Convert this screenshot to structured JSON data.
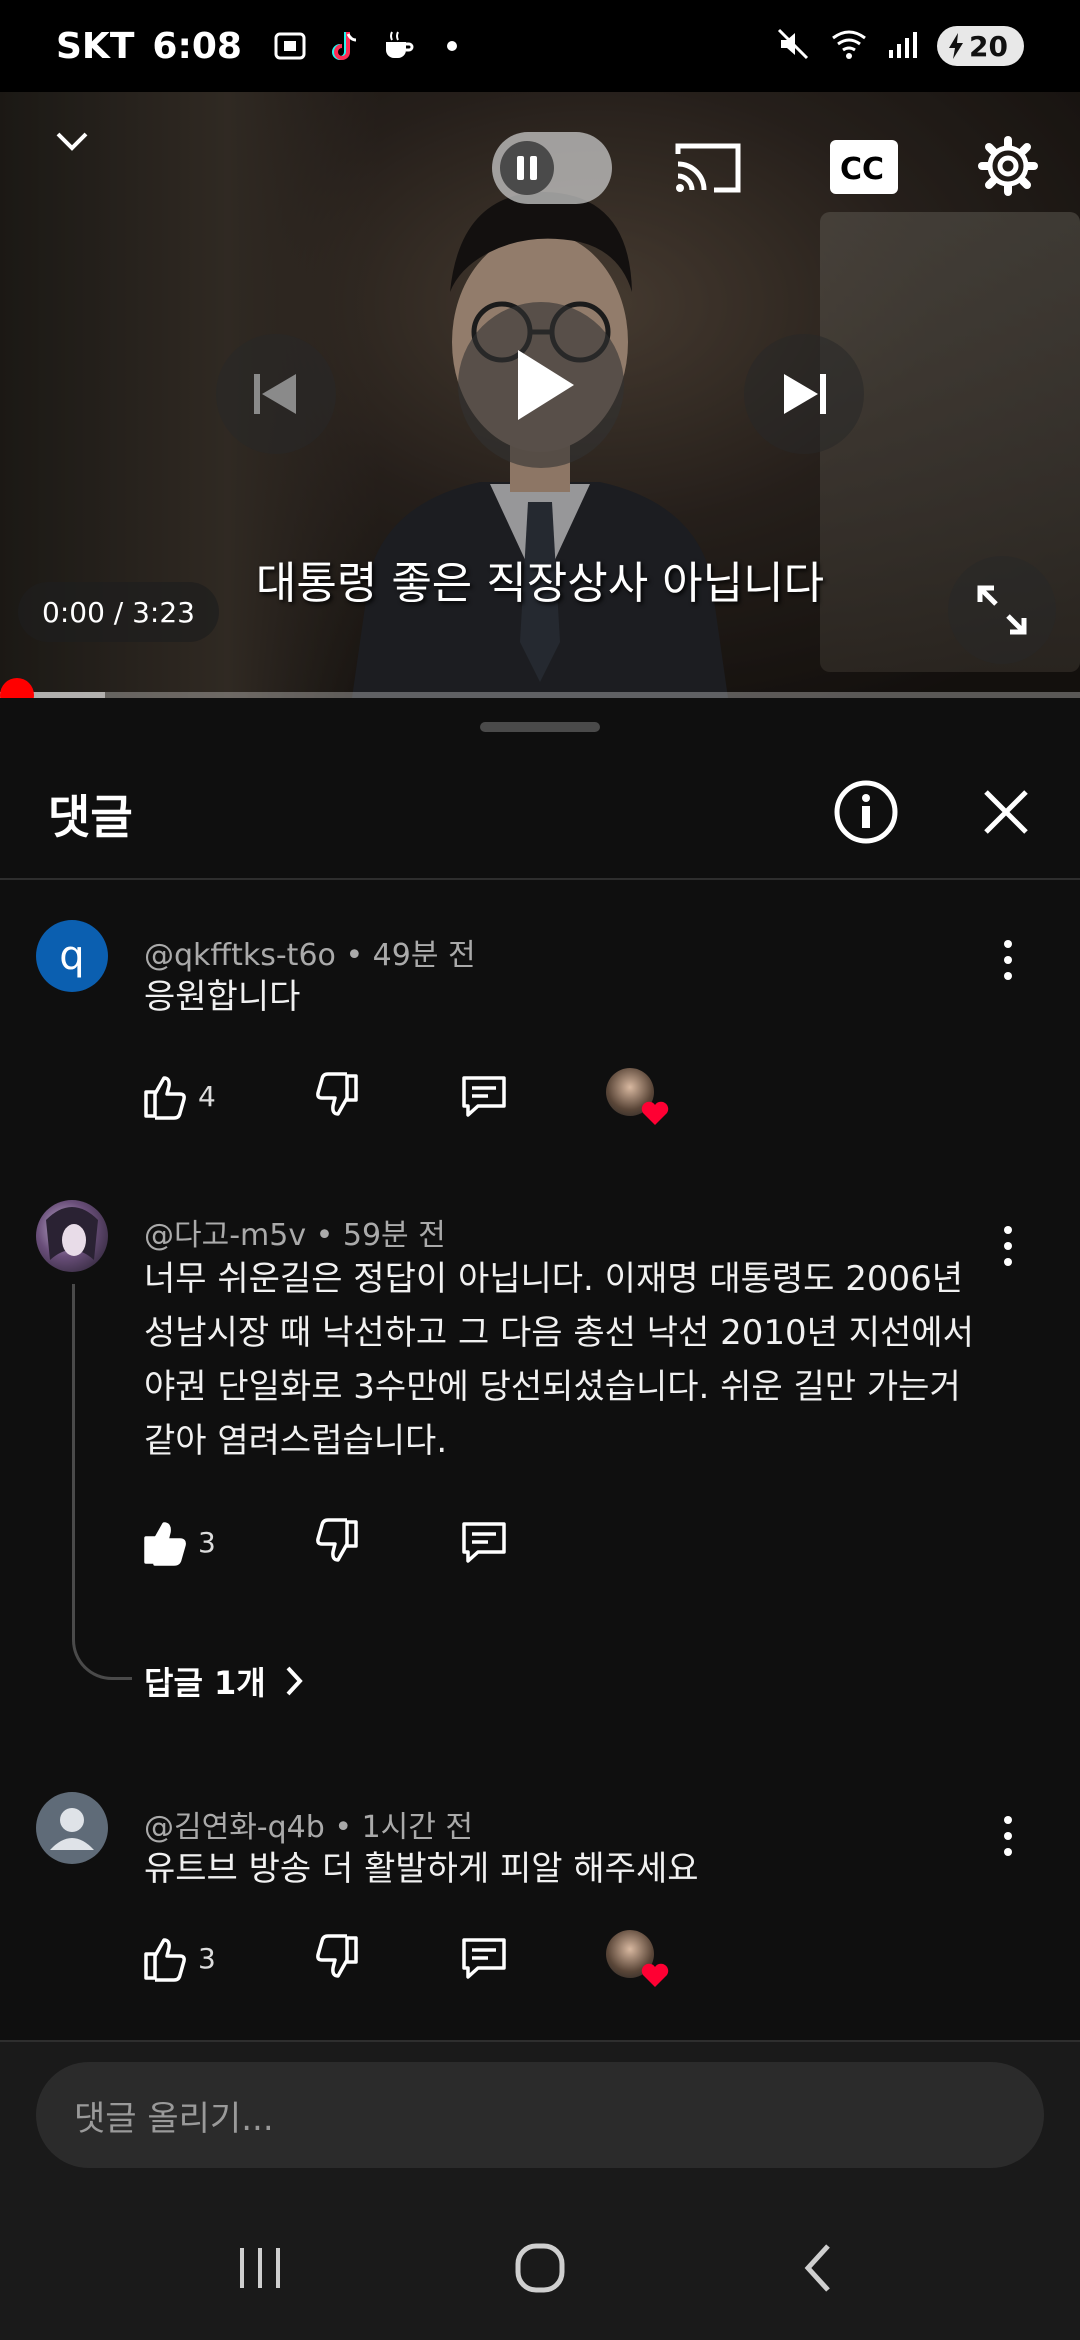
{
  "status_bar": {
    "carrier": "SKT",
    "time": "6:08",
    "battery": "20"
  },
  "video": {
    "subtitle": "대통령 좋은 직장상사 아닙니다",
    "time_display": "0:00 / 3:23",
    "progress_fraction": 0.0
  },
  "comments_panel": {
    "title": "댓글",
    "comments": [
      {
        "author": "@qkfftks-t6o",
        "age": "49분 전",
        "text": "응원합니다",
        "likes": "4",
        "avatar_letter": "q",
        "creator_hearted": true
      },
      {
        "author": "@다고-m5v",
        "age": "59분 전",
        "text": "너무 쉬운길은 정답이 아닙니다. 이재명 대통령도 2006년 성남시장 때 낙선하고 그 다음 총선 낙선 2010년 지선에서 야권 단일화로 3수만에 당선되셨습니다. 쉬운 길만 가는거 같아 염려스럽습니다.",
        "likes": "3",
        "creator_hearted": false,
        "replies_label": "답글 1개"
      },
      {
        "author": "@김연화-q4b",
        "age": "1시간 전",
        "text": "유트브 방송 더 활발하게 피알 해주세요",
        "likes": "3",
        "creator_hearted": true
      }
    ]
  },
  "input": {
    "placeholder": "댓글 올리기..."
  },
  "colors": {
    "accent": "#ff0000",
    "background": "#0f0f0f",
    "avatar_q": "#0b5fb0"
  }
}
